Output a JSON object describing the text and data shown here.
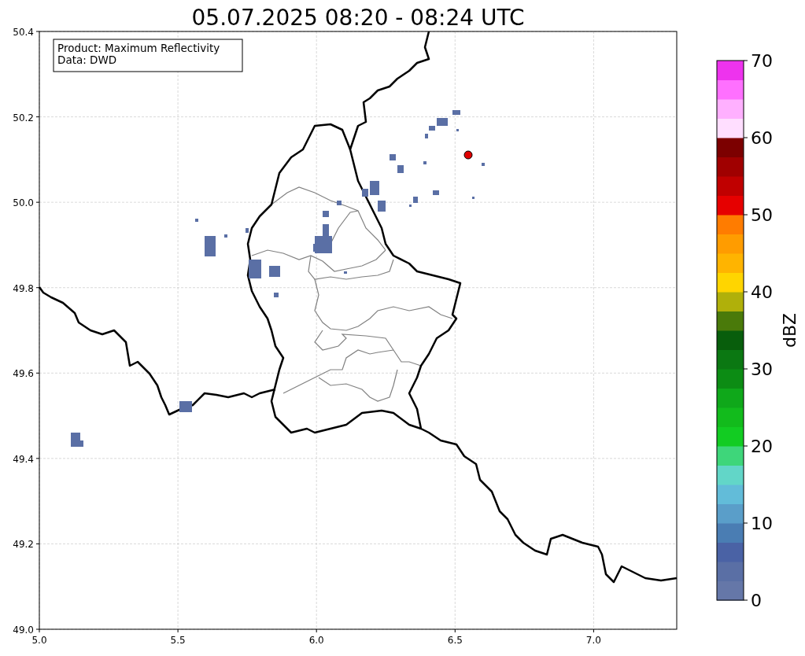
{
  "title": "05.07.2025 08:20 - 08:24 UTC",
  "legend": [
    "Product: Maximum Reflectivity",
    "Data: DWD"
  ],
  "map": {
    "xticks": [
      "5.0",
      "5.5",
      "6.0",
      "6.5",
      "7.0"
    ],
    "yticks": [
      "50.4",
      "50.2",
      "50.0",
      "49.8",
      "49.6",
      "49.4",
      "49.2",
      "49.0"
    ]
  },
  "colorbar": {
    "label": "dBZ",
    "ticks": [
      "70",
      "60",
      "50",
      "40",
      "30",
      "20",
      "10",
      "0"
    ],
    "segments": [
      {
        "color": "#6577a8"
      },
      {
        "color": "#5a6fa5"
      },
      {
        "color": "#4a62a5"
      },
      {
        "color": "#4a7db3"
      },
      {
        "color": "#5a9ec9"
      },
      {
        "color": "#62bcd9"
      },
      {
        "color": "#62d6c8"
      },
      {
        "color": "#3ed67a"
      },
      {
        "color": "#12cc22"
      },
      {
        "color": "#12bb1c"
      },
      {
        "color": "#0fa81a"
      },
      {
        "color": "#0c8c14"
      },
      {
        "color": "#0b7812"
      },
      {
        "color": "#085e0c"
      },
      {
        "color": "#4a7a0a"
      },
      {
        "color": "#b0b00a"
      },
      {
        "color": "#ffd500"
      },
      {
        "color": "#ffb400"
      },
      {
        "color": "#ff9c00"
      },
      {
        "color": "#ff7c00"
      },
      {
        "color": "#e60000"
      },
      {
        "color": "#c00000"
      },
      {
        "color": "#a00000"
      },
      {
        "color": "#7c0000"
      },
      {
        "color": "#ffdeff"
      },
      {
        "color": "#ffb0ff"
      },
      {
        "color": "#ff70ff"
      },
      {
        "color": "#ee33ee"
      }
    ]
  }
}
